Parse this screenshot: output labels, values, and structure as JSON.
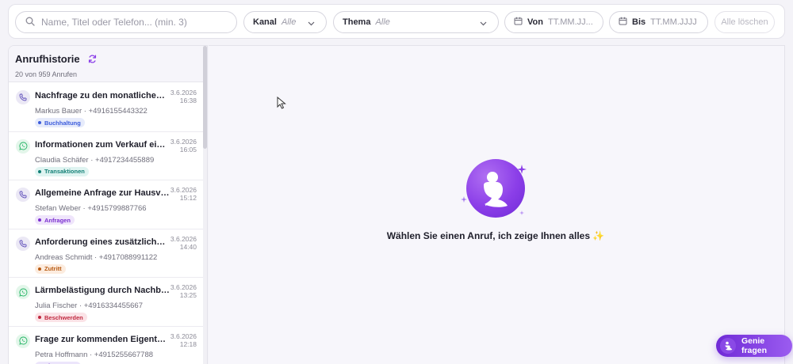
{
  "filters": {
    "search_placeholder": "Name, Titel oder Telefon... (min. 3)",
    "kanal": {
      "label": "Kanal",
      "value": "Alle"
    },
    "thema": {
      "label": "Thema",
      "value": "Alle"
    },
    "von": {
      "label": "Von",
      "placeholder": "TT.MM.JJ..."
    },
    "bis": {
      "label": "Bis",
      "placeholder": "TT.MM.JJJJ"
    },
    "clear_label": "Alle löschen"
  },
  "sidebar": {
    "title": "Anrufhistorie",
    "count": "20 von 959 Anrufen",
    "calls": [
      {
        "channel": "phone",
        "subject": "Nachfrage zu den monatlichen Nebenkosten",
        "caller": "Markus Bauer · +4916155443322",
        "date": "3.6.2026",
        "time": "16:38",
        "tag": "Buchhaltung",
        "tag_color": "#3b5bdb",
        "tag_bg": "#e6ebfb"
      },
      {
        "channel": "whatsapp",
        "subject": "Informationen zum Verkauf einer Eigentumswohnung",
        "caller": "Claudia Schäfer · +4917234455889",
        "date": "3.6.2026",
        "time": "16:05",
        "tag": "Transaktionen",
        "tag_color": "#127f76",
        "tag_bg": "#dff4f1"
      },
      {
        "channel": "phone",
        "subject": "Allgemeine Anfrage zur Hausverwaltung",
        "caller": "Stefan Weber · +4915799887766",
        "date": "3.6.2026",
        "time": "15:12",
        "tag": "Anfragen",
        "tag_color": "#7b2fd0",
        "tag_bg": "#efe5fb"
      },
      {
        "channel": "phone",
        "subject": "Anforderung eines zusätzlichen Wohnungsschlüssels",
        "caller": "Andreas Schmidt · +4917088991122",
        "date": "3.6.2026",
        "time": "14:40",
        "tag": "Zutritt",
        "tag_color": "#b85a12",
        "tag_bg": "#fcecdf"
      },
      {
        "channel": "whatsapp",
        "subject": "Lärmbelästigung durch Nachbarn am Abend",
        "caller": "Julia Fischer · +4916334455667",
        "date": "3.6.2026",
        "time": "13:25",
        "tag": "Beschwerden",
        "tag_color": "#c0283f",
        "tag_bg": "#fbe3e7"
      },
      {
        "channel": "whatsapp",
        "subject": "Frage zur kommenden Eigentümerversammlung",
        "caller": "Petra Hoffmann · +4915255667788",
        "date": "3.6.2026",
        "time": "12:18",
        "tag": "Eigentümer",
        "tag_color": "#6a2fd0",
        "tag_bg": "#ece5fb"
      }
    ]
  },
  "main": {
    "empty_message": "Wählen Sie einen Anruf, ich zeige Ihnen alles ✨"
  },
  "genie": {
    "label": "Genie fragen"
  },
  "colors": {
    "accent": "#8b3ee8",
    "whatsapp": "#25b566",
    "phone": "#5b4ab8"
  }
}
